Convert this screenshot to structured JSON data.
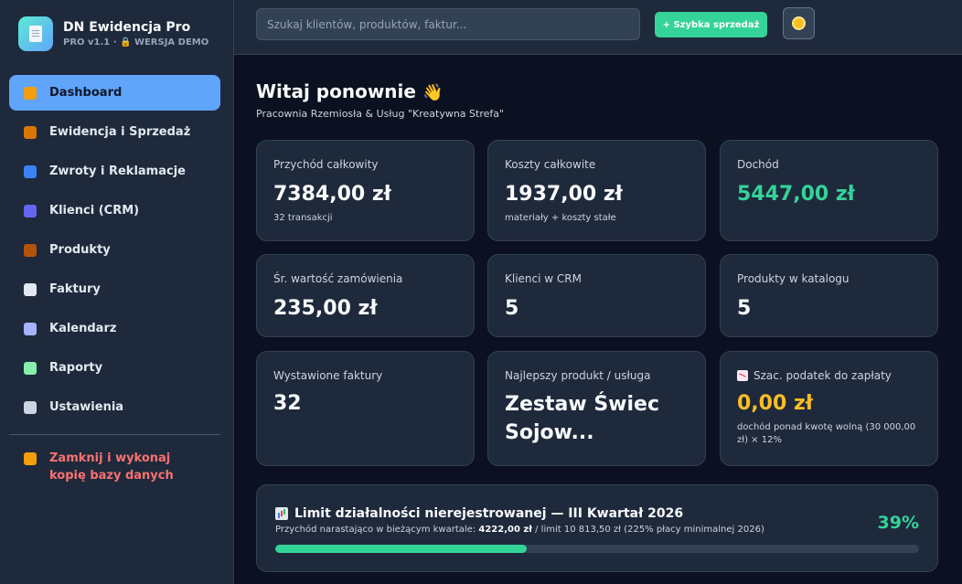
{
  "brand": {
    "title": "DN Ewidencja Pro",
    "subtitle": "PRO v1.1 · 🔒 WERSJA DEMO"
  },
  "sidebar": {
    "items": [
      {
        "label": "Dashboard",
        "icon": "home-icon",
        "active": true,
        "icon_color": "#f59e0b"
      },
      {
        "label": "Ewidencja i Sprzedaż",
        "icon": "money-bag-icon",
        "icon_color": "#d97706"
      },
      {
        "label": "Zwroty i Reklamacje",
        "icon": "refresh-icon",
        "icon_color": "#3b82f6"
      },
      {
        "label": "Klienci (CRM)",
        "icon": "users-icon",
        "icon_color": "#6366f1"
      },
      {
        "label": "Produkty",
        "icon": "package-icon",
        "icon_color": "#b45309"
      },
      {
        "label": "Faktury",
        "icon": "document-icon",
        "icon_color": "#e2e8f0"
      },
      {
        "label": "Kalendarz",
        "icon": "calendar-icon",
        "icon_color": "#a5b4fc"
      },
      {
        "label": "Raporty",
        "icon": "bar-chart-icon",
        "icon_color": "#86efac"
      },
      {
        "label": "Ustawienia",
        "icon": "gear-icon",
        "icon_color": "#cbd5e1"
      }
    ],
    "exit_label": "Zamknij i wykonaj kopię bazy danych"
  },
  "topbar": {
    "search_placeholder": "Szukaj klientów, produktów, faktur...",
    "quick_sale_label": "+ Szybka sprzedaż"
  },
  "main": {
    "welcome": "Witaj ponownie",
    "wave_emoji": "👋",
    "business_name": "Pracownia Rzemiosła & Usług \"Kreatywna Strefa\""
  },
  "cards": {
    "revenue": {
      "label": "Przychód całkowity",
      "value": "7384,00 zł",
      "note": "32 transakcji"
    },
    "costs": {
      "label": "Koszty całkowite",
      "value": "1937,00 zł",
      "note": "materiały + koszty stałe"
    },
    "income": {
      "label": "Dochód",
      "value": "5447,00 zł"
    },
    "avg_order": {
      "label": "Śr. wartość zamówienia",
      "value": "235,00 zł"
    },
    "crm_clients": {
      "label": "Klienci w CRM",
      "value": "5"
    },
    "catalog_products": {
      "label": "Produkty w katalogu",
      "value": "5"
    },
    "invoices": {
      "label": "Wystawione faktury",
      "value": "32"
    },
    "best_product": {
      "label": "Najlepszy produkt / usługa",
      "value": "Zestaw Świec Sojow..."
    },
    "tax": {
      "label": "Szac. podatek do zapłaty",
      "value": "0,00 zł",
      "note": "dochód ponad kwotę wolną (30 000,00 zł) × 12%"
    }
  },
  "limit": {
    "title": "Limit działalności nierejestrowanej — III Kwartał 2026",
    "text_prefix": "Przychód narastająco w bieżącym kwartale:",
    "amount": "4222,00 zł",
    "text_suffix": "/ limit 10 813,50 zł (225% płacy minimalnej 2026)",
    "percent_label": "39%",
    "progress_fraction": 0.39
  },
  "colors": {
    "accent": "#60a5fa",
    "success": "#34d399",
    "warning": "#fbbf24",
    "danger": "#f87171"
  }
}
